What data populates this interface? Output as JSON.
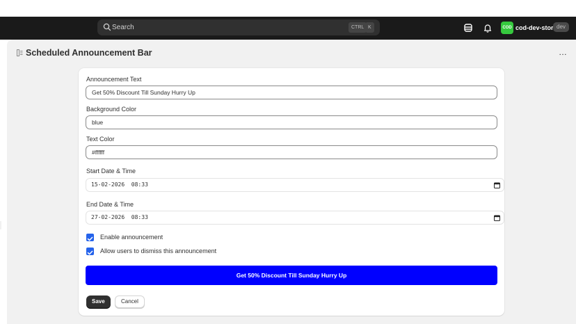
{
  "topbar": {
    "search_placeholder": "Search",
    "shortcut_modifier": "CTRL",
    "shortcut_key": "K",
    "store_avatar": "COD",
    "store_name": "cod-dev-store",
    "store_badge": "dev",
    "icons": [
      "search-icon",
      "storage-icon",
      "bell-icon"
    ]
  },
  "page": {
    "title": "Scheduled Announcement Bar",
    "more_label": "…"
  },
  "form": {
    "announcement_text": {
      "label": "Announcement Text",
      "value": "Get 50% Discount Till Sunday Hurry Up"
    },
    "background_color": {
      "label": "Background Color",
      "value": "blue"
    },
    "text_color": {
      "label": "Text Color",
      "value": "#ffffff"
    },
    "start_datetime": {
      "label": "Start Date & Time",
      "value": "15-02-2026  08:33"
    },
    "end_datetime": {
      "label": "End Date & Time",
      "value": "27-02-2026  08:33"
    },
    "enable_announcement": {
      "label": "Enable announcement",
      "checked": true
    },
    "allow_dismiss": {
      "label": "Allow users to dismiss this announcement",
      "checked": true
    },
    "preview_text": "Get 50% Discount Till Sunday Hurry Up",
    "save_label": "Save",
    "cancel_label": "Cancel"
  },
  "colors": {
    "topbar_bg": "#1a1a1a",
    "page_bg": "#f1f1f1",
    "preview_bg": "#0000ff",
    "preview_text": "#ffffff",
    "checkbox": "#2563eb",
    "store_avatar": "#36c93e"
  }
}
